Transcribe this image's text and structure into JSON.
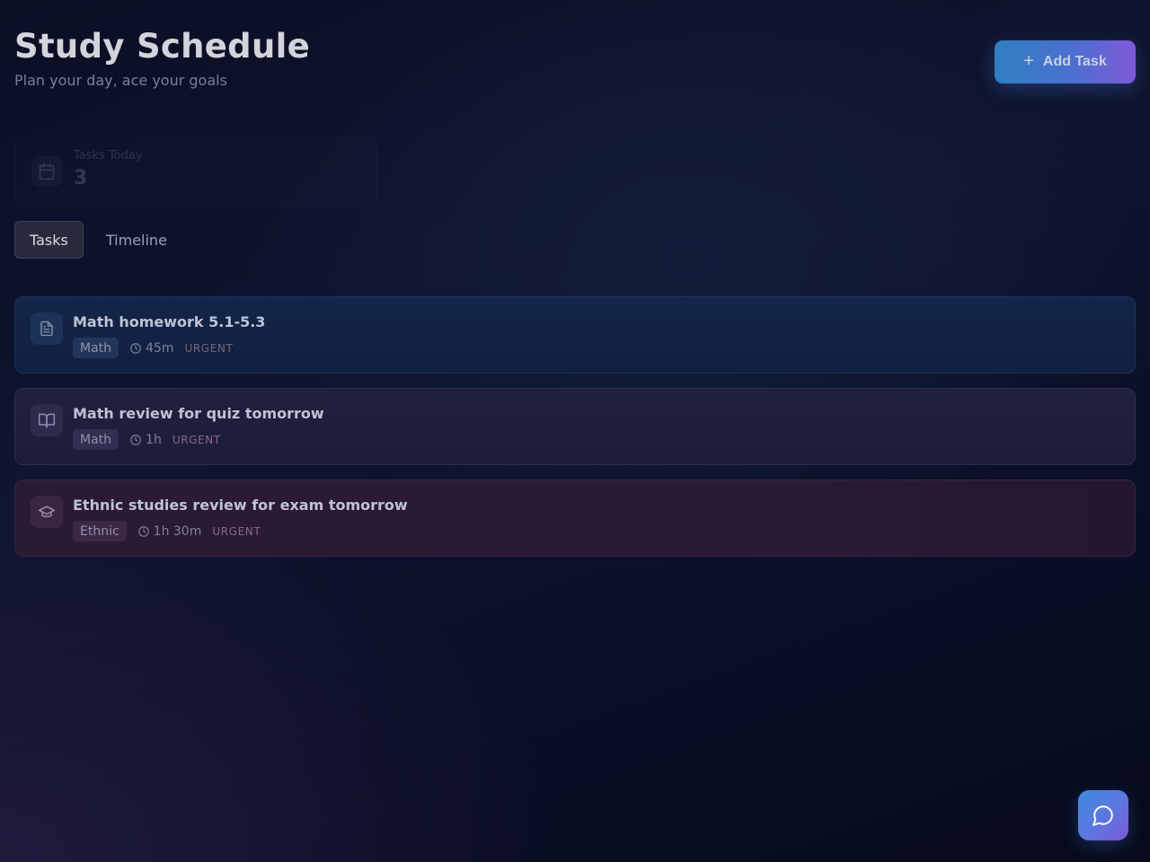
{
  "header": {
    "title": "Study Schedule",
    "subtitle": "Plan your day, ace your goals",
    "add_button": {
      "label": "Add Task",
      "icon": "plus-icon"
    }
  },
  "stats": {
    "tasks_today_label": "Tasks Today",
    "tasks_today_value": "3",
    "icon": "calendar-icon"
  },
  "tabs": [
    {
      "label": "Tasks",
      "active": true
    },
    {
      "label": "Timeline",
      "active": false
    }
  ],
  "tasks": [
    {
      "title": "Math homework 5.1-5.3",
      "subject": "Math",
      "duration": "45m",
      "priority": "URGENT",
      "icon": "document-icon",
      "color": "#13254a"
    },
    {
      "title": "Math review for quiz tomorrow",
      "subject": "Math",
      "duration": "1h",
      "priority": "URGENT",
      "icon": "book-icon",
      "color": "#1e1e3d"
    },
    {
      "title": "Ethnic studies review for exam tomorrow",
      "subject": "Ethnic",
      "duration": "1h 30m",
      "priority": "URGENT",
      "icon": "graduation-cap-icon",
      "color": "#2a1a34"
    }
  ],
  "chat_button": {
    "icon": "chat-bubble-icon"
  },
  "colors": {
    "accent_start": "#2f7fbf",
    "accent_end": "#7f5ad8",
    "background": "#0b0f24"
  }
}
